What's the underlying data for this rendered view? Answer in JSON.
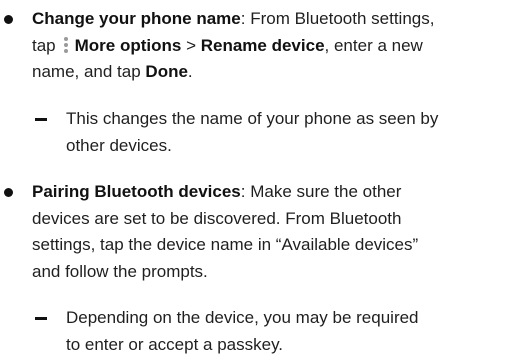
{
  "items": [
    {
      "title": "Change your phone name",
      "text_1": ": From Bluetooth settings,",
      "text_2a": "tap",
      "more_options": "More options",
      "separator": " > ",
      "rename_device": "Rename device",
      "text_2b": ", enter a new",
      "text_3a": "name, and tap ",
      "done": "Done",
      "text_3b": ".",
      "sub_line_1": "This changes the name of your phone as seen by",
      "sub_line_2": "other devices."
    },
    {
      "title": "Pairing Bluetooth devices",
      "text_1": ": Make sure the other",
      "text_2": "devices are set to be discovered. From Bluetooth",
      "text_3": "settings, tap the device name in “Available devices”",
      "text_4": "and follow the prompts.",
      "sub_line_1": "Depending on the device, you may be required",
      "sub_line_2": "to enter or accept a passkey."
    }
  ],
  "icons": {
    "more_options": "more-options-vertical-dots-icon"
  }
}
